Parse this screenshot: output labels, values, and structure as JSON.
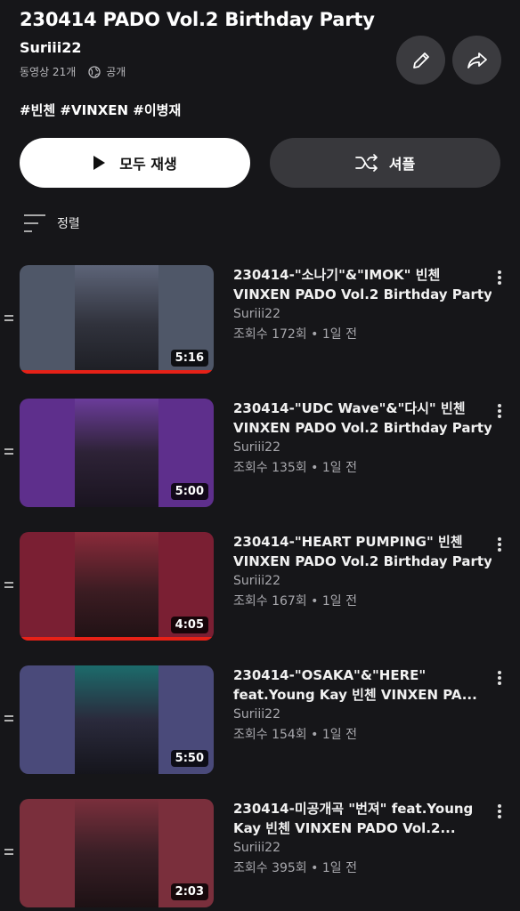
{
  "playlist": {
    "title": "230414 PADO Vol.2 Birthday Party",
    "owner": "Suriii22",
    "video_count": "동영상 21개",
    "visibility": "공개",
    "tags": "#빈첸 #VINXEN #이병재"
  },
  "actions": {
    "play_all_label": "모두 재생",
    "shuffle_label": "셔플",
    "edit_icon": "pencil-icon",
    "share_icon": "share-icon"
  },
  "sort": {
    "label": "정렬"
  },
  "videos": [
    {
      "title_line1": "230414-\"소나기\"&\"IMOK\" 빈첸",
      "title_line2": "VINXEN PADO Vol.2 Birthday Party",
      "channel": "Suriii22",
      "stats": "조회수 172회 • 1일 전",
      "duration": "5:16",
      "watched_fraction": 1.0,
      "thumb_color": "#4f5768"
    },
    {
      "title_line1": "230414-\"UDC Wave\"&\"다시\" 빈첸",
      "title_line2": "VINXEN PADO Vol.2 Birthday Party",
      "channel": "Suriii22",
      "stats": "조회수 135회 • 1일 전",
      "duration": "5:00",
      "watched_fraction": 0,
      "thumb_color": "#5e2f8c"
    },
    {
      "title_line1": "230414-\"HEART PUMPING\" 빈첸",
      "title_line2": "VINXEN PADO Vol.2 Birthday Party",
      "channel": "Suriii22",
      "stats": "조회수 167회 • 1일 전",
      "duration": "4:05",
      "watched_fraction": 1.0,
      "thumb_color": "#7a1f33"
    },
    {
      "title_line1": "230414-\"OSAKA\"&\"HERE\"",
      "title_line2": "feat.Young Kay 빈첸 VINXEN PA...",
      "channel": "Suriii22",
      "stats": "조회수 154회 • 1일 전",
      "duration": "5:50",
      "watched_fraction": 0,
      "thumb_color": "#4a4a7a"
    },
    {
      "title_line1": "230414-미공개곡 \"번져\" feat.Young",
      "title_line2": "Kay 빈첸 VINXEN PADO Vol.2...",
      "channel": "Suriii22",
      "stats": "조회수 395회 • 1일 전",
      "duration": "2:03",
      "watched_fraction": 0,
      "thumb_color": "#7a2f3c"
    }
  ]
}
